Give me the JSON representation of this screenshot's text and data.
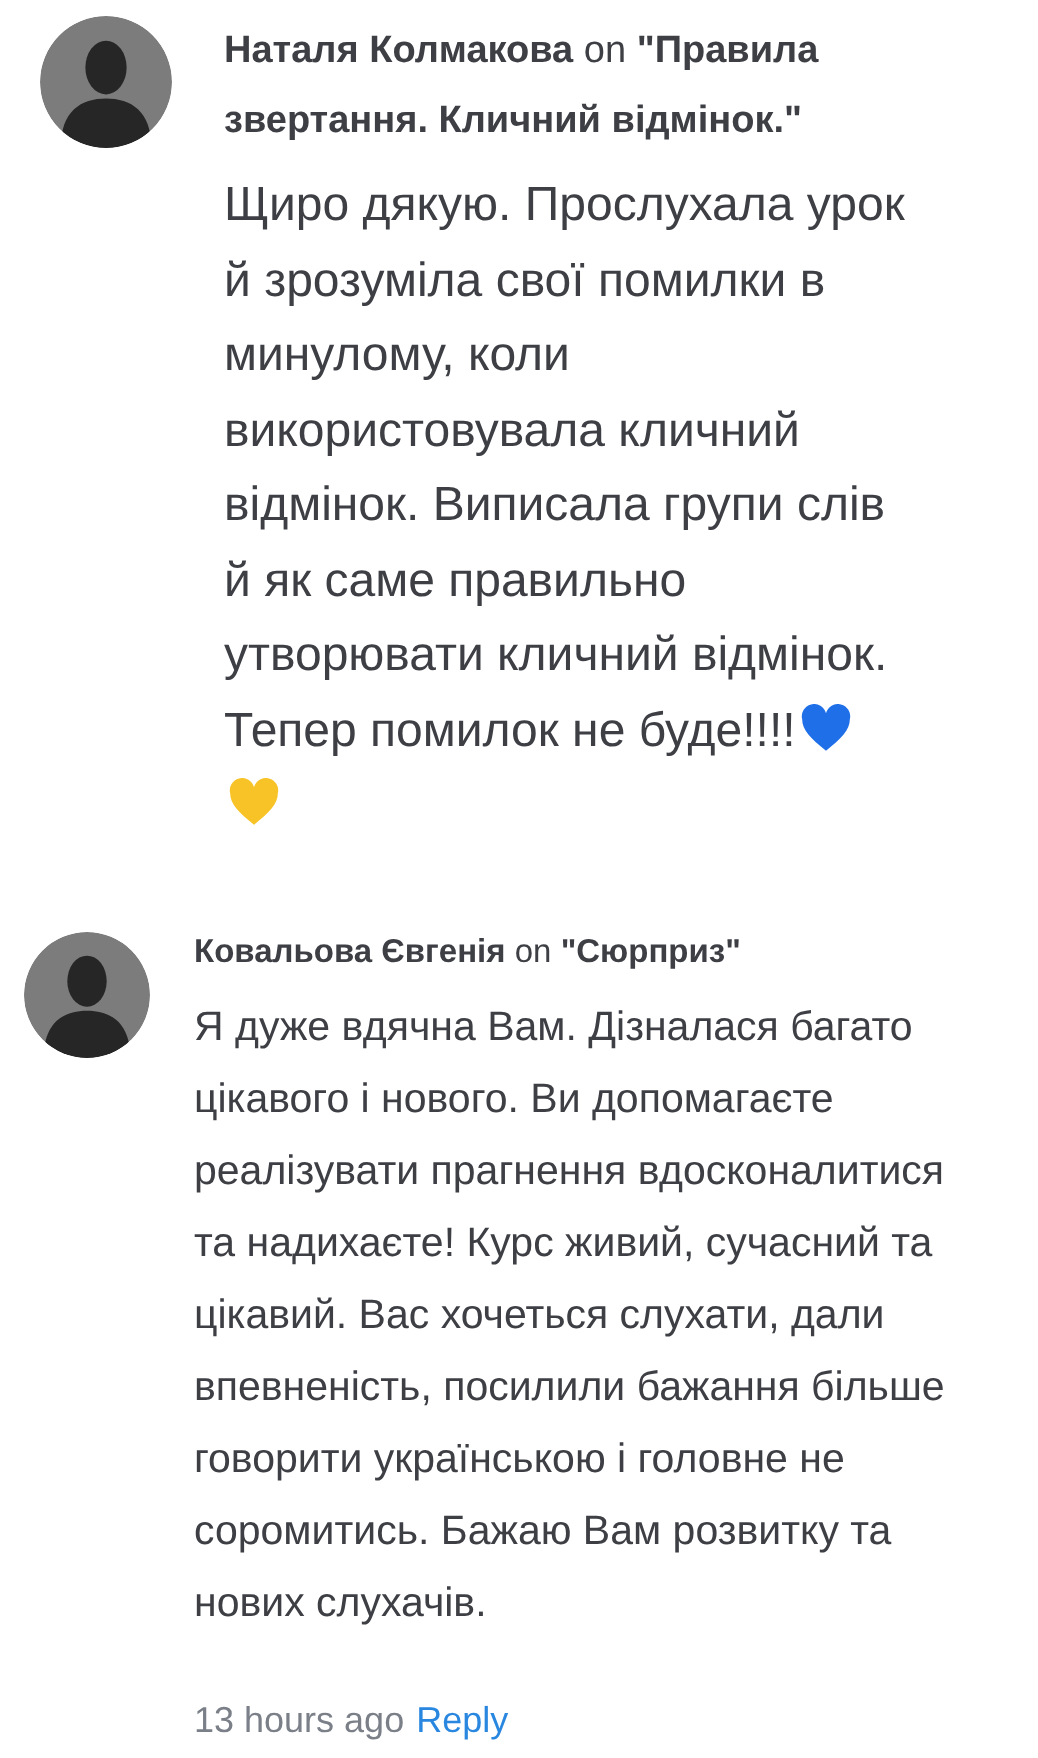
{
  "comments": [
    {
      "author": "Наталя Колмакова",
      "on": "on",
      "post": "\"Правила звертання. Кличний відмінок.\"",
      "body": "Щиро дякую. Прослухала урок й зрозуміла свої помилки в минулому, коли використовувала кличний відмінок. Виписала групи слів й як саме правильно утворювати кличний відмінок. Тепер помилок не буде!!!!",
      "hearts": true
    },
    {
      "author": "Ковальова Євгенія",
      "on": "on",
      "post": "\"Сюрприз\"",
      "body": "Я дуже вдячна Вам. Дізналася багато цікавого і нового. Ви допомагаєте реалізувати прагнення вдосконалитися та надихаєте! Курс живий, сучасний та цікавий. Вас хочеться слухати, дали впевненість, посилили бажання більше говорити українською і головне не соромитись. Бажаю Вам розвитку та нових слухачів.",
      "hearts": false,
      "time": "13 hours ago",
      "reply": "Reply"
    }
  ]
}
